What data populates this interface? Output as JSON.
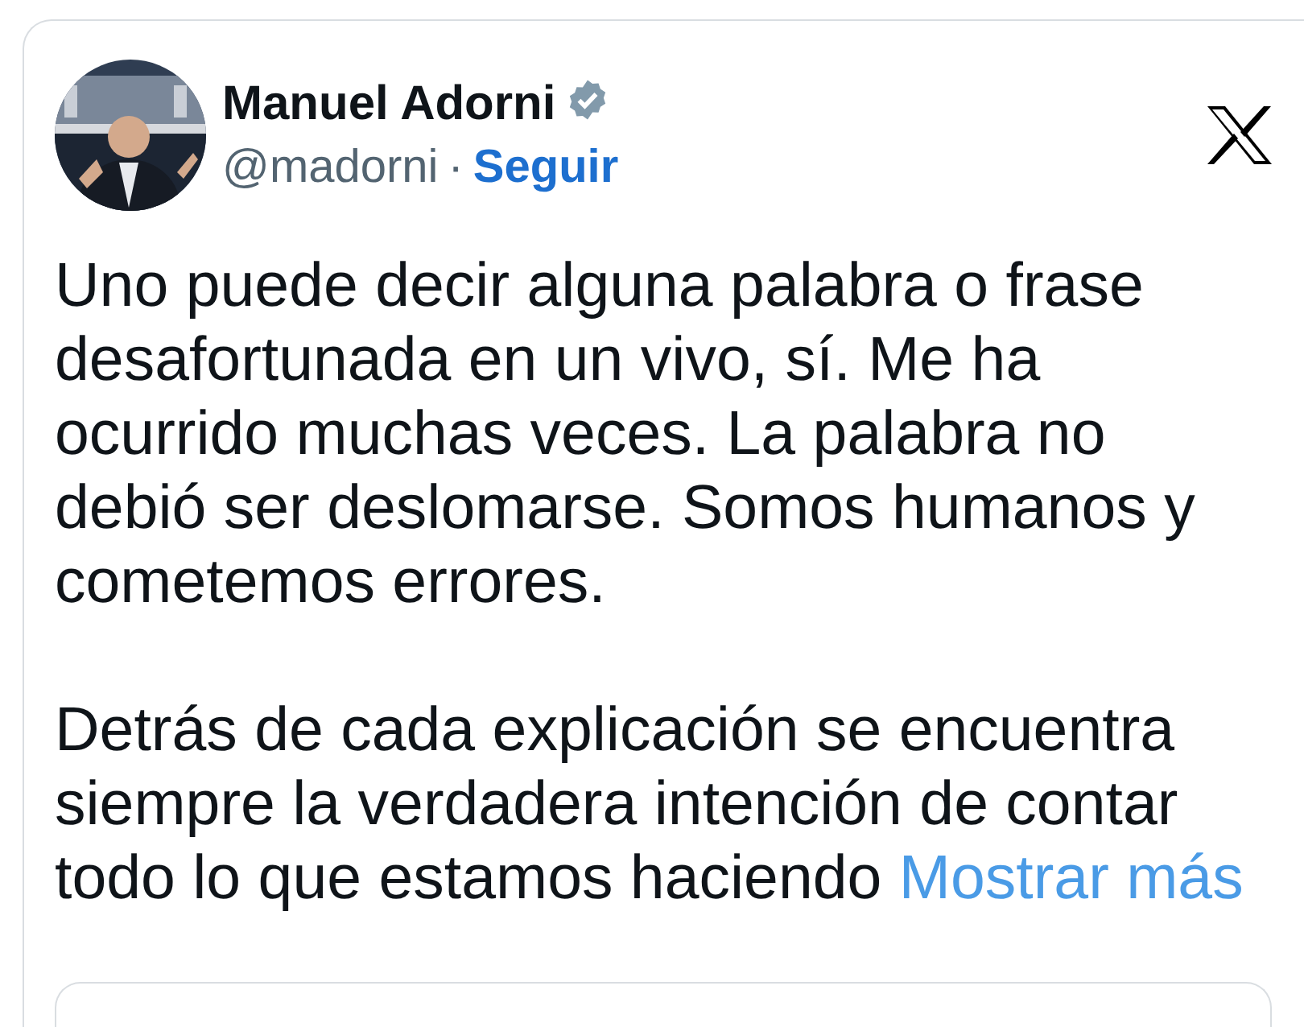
{
  "author": {
    "name": "Manuel Adorni",
    "verified": true,
    "handle": "@madorni",
    "separator": "·",
    "follow": "Seguir"
  },
  "paragraphs": [
    {
      "text": "Uno puede decir alguna palabra o frase\ndesafortunada en un vivo, sí. Me ha\nocurrido muchas veces. La palabra no\ndebió ser deslomarse. Somos humanos y\ncometemos errores."
    },
    {
      "text": "Detrás de cada explicación se encuentra\nsiempre la verdadera intención de contar\ntodo lo que estamos haciendo",
      "more": "Mostrar más"
    }
  ]
}
